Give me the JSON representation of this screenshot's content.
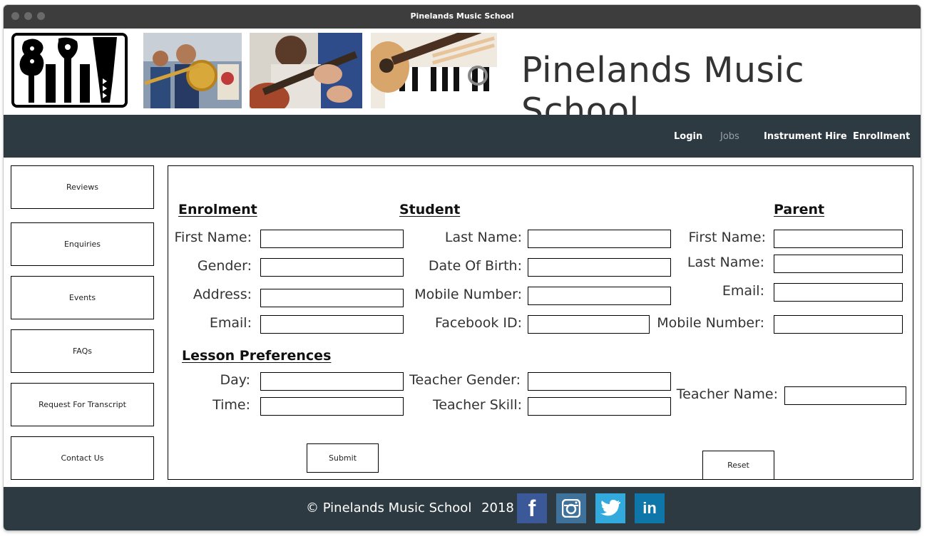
{
  "window": {
    "title": "Pinelands Music School"
  },
  "header": {
    "site_title": "Pinelands Music School"
  },
  "nav": {
    "items": [
      "Login",
      "Jobs",
      "Instrument Hire",
      "Enrollment"
    ]
  },
  "sidebar": {
    "items": [
      "Reviews",
      "Enquiries",
      "Events",
      "FAQs",
      "Request For Transcript",
      "Contact Us"
    ]
  },
  "form": {
    "headings": {
      "enrolment": "Enrolment",
      "student": "Student",
      "parent": "Parent",
      "lesson": "Lesson Preferences"
    },
    "student_labels": {
      "first_name": "First Name:",
      "gender": "Gender:",
      "address": "Address:",
      "email": "Email:",
      "last_name": "Last Name:",
      "dob": "Date Of Birth:",
      "mobile": "Mobile Number:",
      "facebook": "Facebook ID:"
    },
    "parent_labels": {
      "first_name": "First Name:",
      "last_name": "Last Name:",
      "email": "Email:",
      "mobile": "Mobile Number:"
    },
    "lesson_labels": {
      "day": "Day:",
      "time": "Time:",
      "teacher_gender": "Teacher Gender:",
      "teacher_skill": "Teacher Skill:",
      "teacher_name": "Teacher Name:"
    },
    "buttons": {
      "submit": "Submit",
      "reset": "Reset"
    }
  },
  "footer": {
    "copyright": "© Pinelands Music School",
    "year": "2018"
  },
  "social": [
    {
      "name": "facebook",
      "glyph": "f",
      "color": "#3b5998"
    },
    {
      "name": "instagram",
      "glyph": "◙",
      "color": "#3f729b"
    },
    {
      "name": "twitter",
      "glyph": "t",
      "color": "#33aadd"
    },
    {
      "name": "linkedin",
      "glyph": "in",
      "color": "#0e76a8"
    }
  ],
  "colors": {
    "nav_bg": "#2e3a42",
    "titlebar_bg": "#3d3d3d"
  }
}
